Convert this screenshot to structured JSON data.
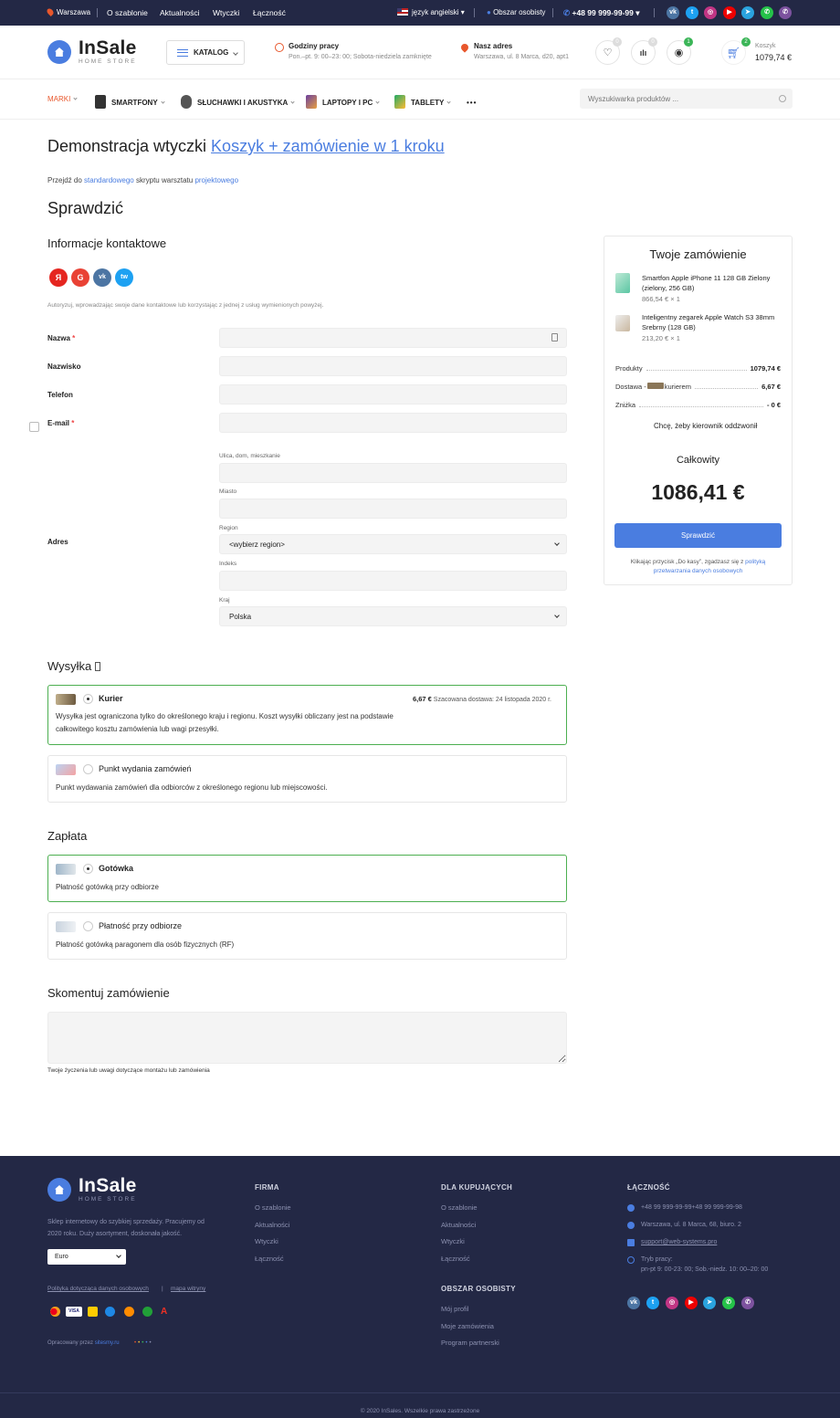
{
  "topbar": {
    "city": "Warszawa",
    "links": [
      "O szablonie",
      "Aktualności",
      "Wtyczki",
      "Łączność"
    ],
    "language": "język angielski",
    "account": "Obszar osobisty",
    "phone": "+48 99 999-99-99",
    "social": [
      "vk",
      "twitter",
      "instagram",
      "youtube",
      "telegram",
      "whatsapp",
      "viber"
    ]
  },
  "header": {
    "logo_name": "InSale",
    "logo_sub": "HOME STORE",
    "catalog_label": "KATALOG",
    "hours_title": "Godziny pracy",
    "hours_text": "Pon.–pt. 9: 00–23: 00; Sobota-niedziela zamknięte",
    "address_title": "Nasz adres",
    "address_text": "Warszawa, ul. 8 Marca, d20, apt1",
    "wishlist_count": "0",
    "compare_count": "0",
    "viewed_count": "1",
    "cart_count": "2",
    "cart_label": "Koszyk",
    "cart_total": "1079,74 €"
  },
  "nav": {
    "items": [
      "MARKI",
      "SMARTFONY",
      "SŁUCHAWKI I AKUSTYKA",
      "LAPTOPY I PC",
      "TABLETY"
    ],
    "more": "•••",
    "search_placeholder": "Wyszukiwarka produktów ..."
  },
  "page": {
    "title_prefix": "Demonstracja wtyczki ",
    "title_link": "Koszyk + zamówienie w 1 kroku",
    "sub_prefix": "Przejdź do ",
    "sub_link1": "standardowego",
    "sub_middle": " skryptu warsztatu ",
    "sub_link2": "projektowego",
    "checkout_title": "Sprawdzić",
    "contact_title": "Informacje kontaktowe",
    "auth_services": [
      "Я",
      "G",
      "vk",
      "tw"
    ],
    "auth_note": "Autoryzuj, wprowadzając swoje dane kontaktowe lub korzystając z jednej z usług wymienionych powyżej.",
    "fields": {
      "name": "Nazwa",
      "surname": "Nazwisko",
      "phone": "Telefon",
      "email": "E-mail",
      "address": "Adres",
      "required_mark": "*"
    },
    "address_fields": {
      "street": "Ulica, dom, mieszkanie",
      "city": "Miasto",
      "region": "Region",
      "region_value": "<wybierz region>",
      "zip": "Indeks",
      "country": "Kraj",
      "country_value": "Polska"
    },
    "shipping_title": "Wysyłka ",
    "shipping": [
      {
        "title": "Kurier",
        "price": "6,67 €",
        "estimate": " Szacowana dostawa: 24 listopada 2020 r.",
        "desc": "Wysyłka jest ograniczona tylko do określonego kraju i regionu. Koszt wysyłki obliczany jest na podstawie całkowitego kosztu zamówienia lub wagi przesyłki."
      },
      {
        "title": "Punkt wydania zamówień",
        "desc": "Punkt wydawania zamówień dla odbiorców z określonego regionu lub miejscowości."
      }
    ],
    "payment_title": "Zapłata",
    "payment": [
      {
        "title": "Gotówka",
        "desc": "Płatność gotówką przy odbiorze"
      },
      {
        "title": "Płatność przy odbiorze",
        "desc": "Płatność gotówką paragonem dla osób fizycznych (RF)"
      }
    ],
    "comment_title": "Skomentuj zamówienie",
    "comment_note": "Twoje życzenia lub uwagi dotyczące montażu lub zamówienia"
  },
  "summary": {
    "title": "Twoje zamówienie",
    "products": [
      {
        "name": "Smartfon Apple iPhone 11 128 GB Zielony (zielony, 256 GB)",
        "price": "866,54 € × 1"
      },
      {
        "name": "Inteligentny zegarek Apple Watch S3 38mm Srebrny (128 GB)",
        "price": "213,20 € × 1"
      }
    ],
    "products_label": "Produkty",
    "products_value": "1079,74 €",
    "delivery_label_prefix": "Dostawa - ",
    "delivery_label_suffix": " kurierem",
    "delivery_value": "6,67 €",
    "discount_label": "Zniżka",
    "discount_value": "- 0 €",
    "callback_label": "Chcę, żeby kierownik oddzwonił",
    "total_label": "Całkowity",
    "total_value": "1086,41 €",
    "submit_label": "Sprawdzić",
    "legal_prefix": "Klikając przycisk „Do kasy”, zgadzasz się z ",
    "legal_link": "polityką przetwarzania danych osobowych"
  },
  "footer": {
    "logo_name": "InSale",
    "logo_sub": "HOME STORE",
    "desc": "Sklep internetowy do szybkiej sprzedaży. Pracujemy od 2020 roku. Duży asortyment, doskonała jakość.",
    "currency": "Euro",
    "policy_link": "Polityka dotycząca danych osobowych",
    "sitemap_link": "mapa witryny",
    "developed_by": "Opracowany przez ",
    "developer_link": "sitesmy.ru",
    "col1_title": "FIRMA",
    "col1_links": [
      "O szablonie",
      "Aktualności",
      "Wtyczki",
      "Łączność"
    ],
    "col2_title": "DLA KUPUJĄCYCH",
    "col2_links": [
      "O szablonie",
      "Aktualności",
      "Wtyczki",
      "Łączność"
    ],
    "col3_title": "OBSZAR OSOBISTY",
    "col3_links": [
      "Mój profil",
      "Moje zamówienia",
      "Program partnerski"
    ],
    "col4_title": "ŁĄCZNOŚĆ",
    "contact_phone": "+48 99 999-99-99+48 99 999-99-98",
    "contact_address": "Warszawa, ul. 8 Marca, 68, biuro. 2",
    "contact_email": "support@web-systems.pro",
    "contact_hours_title": "Tryb pracy:",
    "contact_hours": "pn-pt 9: 00-23: 00; Sob.-niedz. 10: 00–20: 00",
    "copyright": "© 2020 InSales. Wszelkie prawa zastrzeżone"
  },
  "colors": {
    "accent": "#4a7de0",
    "dark": "#232845",
    "orange": "#e8572c",
    "green": "#4caf50"
  }
}
